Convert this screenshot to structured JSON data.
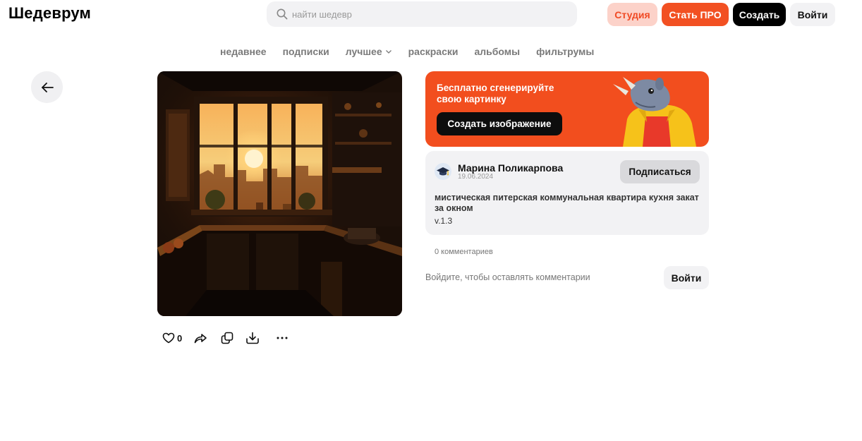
{
  "header": {
    "logo": "Шедеврум",
    "search_placeholder": "найти шедевр",
    "studio_label": "Студия",
    "pro_label": "Стать ПРО",
    "create_label": "Создать",
    "login_label": "Войти"
  },
  "tabs": [
    {
      "label": "недавнее"
    },
    {
      "label": "подписки"
    },
    {
      "label": "лучшее"
    },
    {
      "label": "раскраски"
    },
    {
      "label": "альбомы"
    },
    {
      "label": "фильтрумы"
    }
  ],
  "post": {
    "likes": "0"
  },
  "promo": {
    "text": "Бесплатно сгенерируйте свою картинку",
    "button": "Создать изображение"
  },
  "author": {
    "name": "Марина Поликарпова",
    "date": "19.06.2024",
    "subscribe_label": "Подписаться"
  },
  "prompt": {
    "text": "мистическая питерская коммунальная квартира кухня закат за окном",
    "version": "v.1.3"
  },
  "comments": {
    "count_text": "0 комментариев",
    "login_hint": "Войдите, чтобы оставлять комментарии",
    "login_label": "Войти"
  },
  "colors": {
    "accent": "#f25022",
    "studio_bg": "#fcd2c9",
    "card_bg": "#f2f2f4"
  },
  "icons": [
    "search-icon",
    "chevron-down-icon",
    "arrow-left-icon",
    "heart-icon",
    "share-icon",
    "copy-icon",
    "download-icon",
    "more-icon",
    "graduation-cap-icon"
  ]
}
